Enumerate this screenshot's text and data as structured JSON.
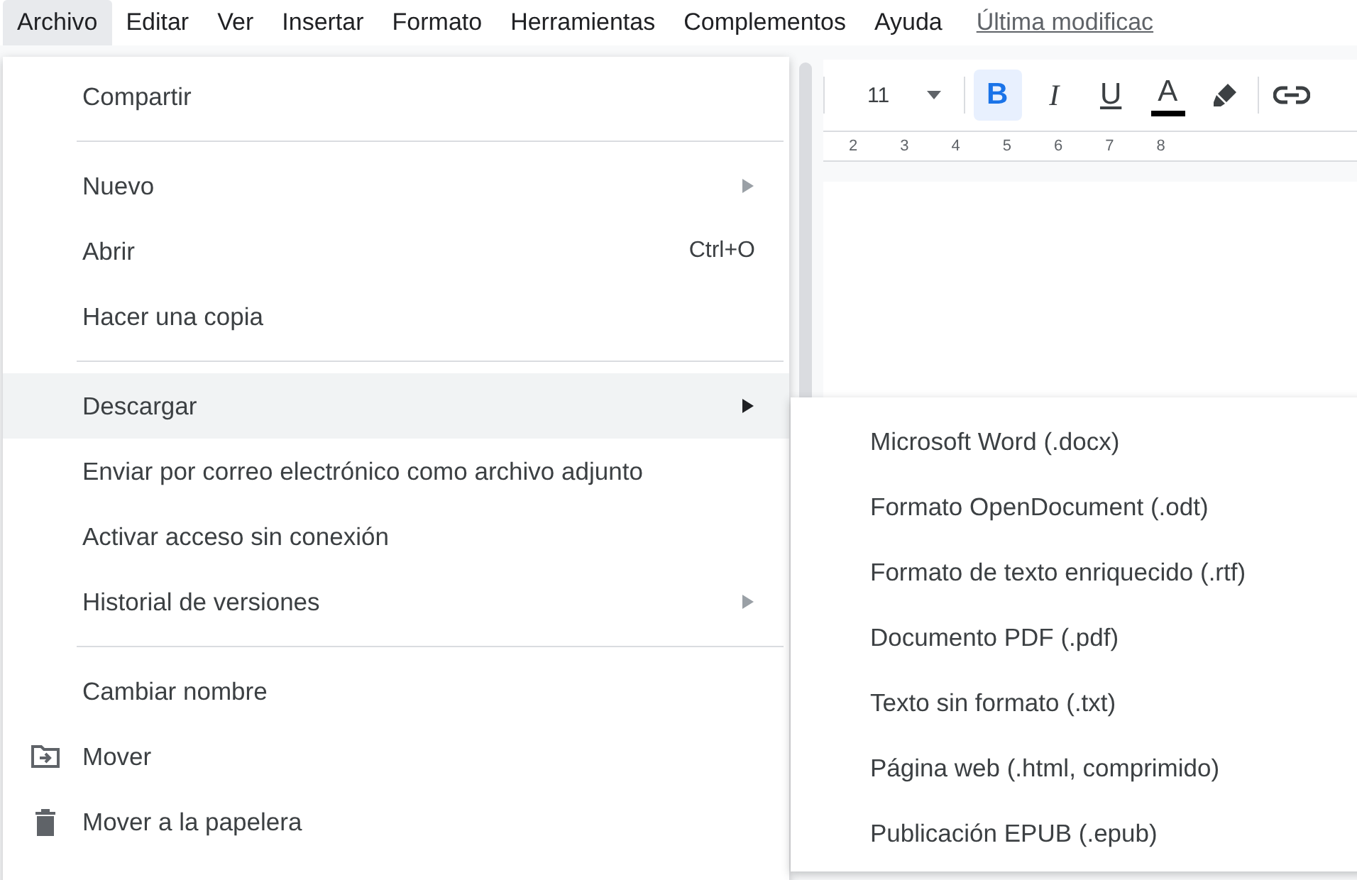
{
  "menubar": {
    "items": [
      {
        "label": "Archivo",
        "selected": true
      },
      {
        "label": "Editar",
        "selected": false
      },
      {
        "label": "Ver",
        "selected": false
      },
      {
        "label": "Insertar",
        "selected": false
      },
      {
        "label": "Formato",
        "selected": false
      },
      {
        "label": "Herramientas",
        "selected": false
      },
      {
        "label": "Complementos",
        "selected": false
      },
      {
        "label": "Ayuda",
        "selected": false
      }
    ],
    "last_edit": "Última modificac"
  },
  "toolbar": {
    "font_size": "11",
    "buttons": [
      {
        "kind": "bold",
        "label": "B",
        "selected": true
      },
      {
        "kind": "italic",
        "label": "I",
        "selected": false
      },
      {
        "kind": "underline",
        "label": "U",
        "selected": false
      },
      {
        "kind": "color",
        "label": "A",
        "selected": false
      }
    ]
  },
  "ruler": {
    "labels": [
      "2",
      "3",
      "4",
      "5",
      "6",
      "7",
      "8"
    ]
  },
  "file_menu": {
    "items": [
      {
        "kind": "item",
        "label": "Compartir",
        "highlighted": false
      },
      {
        "kind": "separator"
      },
      {
        "kind": "item",
        "label": "Nuevo",
        "submenu": true,
        "highlighted": false
      },
      {
        "kind": "item",
        "label": "Abrir",
        "shortcut": "Ctrl+O",
        "highlighted": false
      },
      {
        "kind": "item",
        "label": "Hacer una copia",
        "highlighted": false
      },
      {
        "kind": "separator"
      },
      {
        "kind": "item",
        "label": "Descargar",
        "submenu": true,
        "highlighted": true
      },
      {
        "kind": "item",
        "label": "Enviar por correo electrónico como archivo adjunto",
        "highlighted": false
      },
      {
        "kind": "item",
        "label": "Activar acceso sin conexión",
        "highlighted": false
      },
      {
        "kind": "item",
        "label": "Historial de versiones",
        "submenu": true,
        "highlighted": false
      },
      {
        "kind": "separator"
      },
      {
        "kind": "item",
        "label": "Cambiar nombre",
        "highlighted": false
      },
      {
        "kind": "item",
        "label": "Mover",
        "icon": true,
        "highlighted": false
      },
      {
        "kind": "item",
        "label": "Mover a la papelera",
        "icon": true,
        "highlighted": false
      }
    ]
  },
  "download_submenu": {
    "items": [
      {
        "label": "Microsoft Word (.docx)"
      },
      {
        "label": "Formato OpenDocument (.odt)"
      },
      {
        "label": "Formato de texto enriquecido (.rtf)"
      },
      {
        "label": "Documento PDF (.pdf)"
      },
      {
        "label": "Texto sin formato (.txt)"
      },
      {
        "label": "Página web (.html, comprimido)"
      },
      {
        "label": "Publicación EPUB (.epub)"
      }
    ]
  }
}
